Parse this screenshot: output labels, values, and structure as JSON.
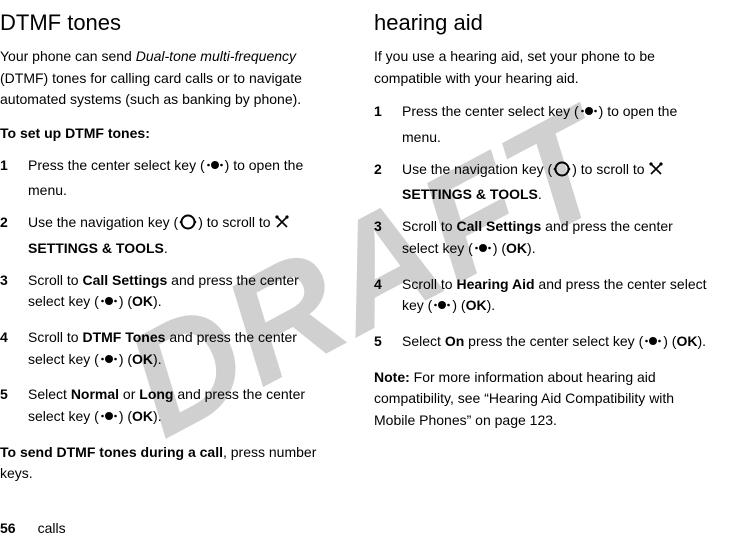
{
  "watermark": "DRAFT",
  "left": {
    "heading": "DTMF tones",
    "intro_pre": "Your phone can send ",
    "intro_em": "Dual-tone multi-frequency",
    "intro_post": " (DTMF) tones for calling card calls or to navigate automated systems (such as banking by phone).",
    "setup_label": "To set up DTMF tones",
    "colon": ":",
    "steps": {
      "s1_pre": "Press the center select key (",
      "s1_post": ") to open the menu.",
      "s2_pre": "Use the navigation key (",
      "s2_mid": ") to scroll to ",
      "s2_dest": "SETTINGS & TOOLS",
      "s2_end": ".",
      "s3_pre": "Scroll to ",
      "s3_target": "Call Settings",
      "s3_mid": " and press the center select key (",
      "s3_ok": "OK",
      "s3_post": ").",
      "s4_pre": "Scroll to ",
      "s4_target": "DTMF Tones",
      "s4_mid": " and press the center select key (",
      "s4_ok": "OK",
      "s4_post": ").",
      "s5_pre": "Select ",
      "s5_opt1": "Normal",
      "s5_or": " or ",
      "s5_opt2": "Long",
      "s5_mid": " and press the center select key (",
      "s5_ok": "OK",
      "s5_post": ")."
    },
    "send_label": "To send DTMF tones during a call",
    "send_post": ", press number keys."
  },
  "right": {
    "heading": "hearing aid",
    "intro": "If you use a hearing aid, set your phone to be compatible with your hearing aid.",
    "steps": {
      "s1_pre": "Press the center select key (",
      "s1_post": ") to open the menu.",
      "s2_pre": "Use the navigation key (",
      "s2_mid": ") to scroll to ",
      "s2_dest": "SETTINGS & TOOLS",
      "s2_end": ".",
      "s3_pre": "Scroll to ",
      "s3_target": "Call Settings",
      "s3_mid": " and press the center select key (",
      "s3_ok": "OK",
      "s3_post": ").",
      "s4_pre": "Scroll to ",
      "s4_target": "Hearing Aid",
      "s4_mid": " and press the center select key (",
      "s4_ok": "OK",
      "s4_post": ").",
      "s5_pre": "Select ",
      "s5_opt": "On",
      "s5_mid": " press the center select key (",
      "s5_ok": "OK",
      "s5_post": ")."
    },
    "note_label": "Note:",
    "note_text": " For more information about hearing aid compatibility, see “Hearing Aid Compatibility with Mobile Phones” on page 123."
  },
  "footer": {
    "page": "56",
    "section": "calls"
  },
  "nums": {
    "n1": "1",
    "n2": "2",
    "n3": "3",
    "n4": "4",
    "n5": "5"
  },
  "paren": {
    "open_ok": ") (",
    "close": ")"
  }
}
